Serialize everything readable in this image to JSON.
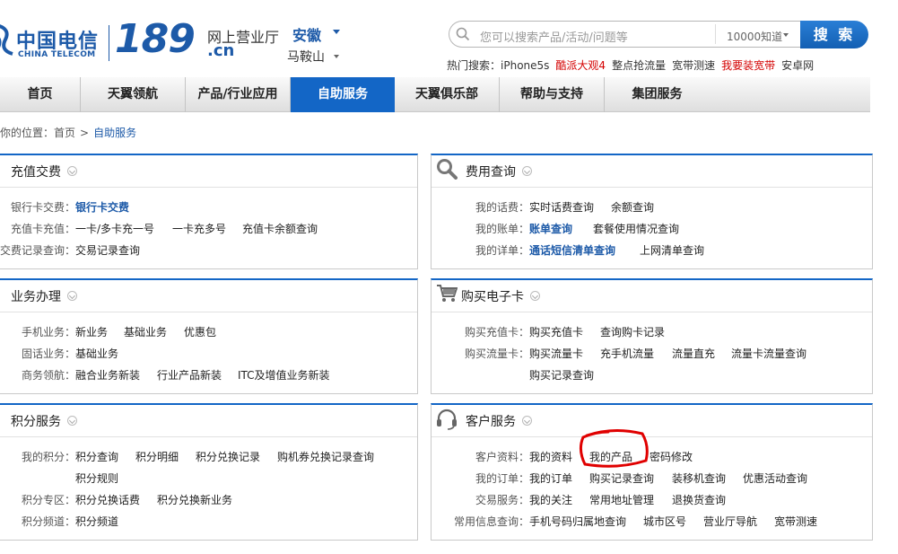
{
  "header": {
    "logo_cn": "中国电信",
    "logo_en": "CHINA TELECOM",
    "logo_num": "189",
    "logo_domain": ".cn",
    "hall": "网上营业厅",
    "province": "安徽",
    "city": "马鞍山",
    "search_placeholder": "您可以搜索产品/活动/问题等",
    "search_scope": "10000知道",
    "search_button": "搜 索",
    "hot_label": "热门搜索：",
    "hot_items": [
      "iPhone5s",
      "酷派大观4",
      "整点抢流量",
      "宽带测速",
      "我要装宽带",
      "安卓网"
    ],
    "accent": "#1366c6",
    "hot_red": "#d40000"
  },
  "nav": [
    "首页",
    "天翼领航",
    "产品/行业应用",
    "自助服务",
    "天翼俱乐部",
    "帮助与支持",
    "集团服务"
  ],
  "breadcrumb": {
    "prefix": "你的位置：",
    "home": "首页",
    "sep": ">",
    "current": "自助服务"
  },
  "panels": {
    "recharge": {
      "title": "充值交费",
      "rows": [
        {
          "label": "银行卡交费：",
          "links": [
            "银行卡交费"
          ]
        },
        {
          "label": "充值卡充值：",
          "links": [
            "一卡/多卡充一号",
            "一卡充多号",
            "充值卡余额查询"
          ]
        },
        {
          "label": "交费记录查询：",
          "links": [
            "交易记录查询"
          ]
        }
      ]
    },
    "fee": {
      "title": "费用查询",
      "icon": "search-icon",
      "rows": [
        {
          "label": "我的话费：",
          "links": [
            "实时话费查询",
            "余额查询"
          ]
        },
        {
          "label": "我的账单：",
          "links": [
            "账单查询",
            "套餐使用情况查询"
          ]
        },
        {
          "label": "我的详单：",
          "links": [
            "通话短信清单查询",
            "上网清单查询"
          ]
        }
      ]
    },
    "business": {
      "title": "业务办理",
      "rows": [
        {
          "label": "手机业务：",
          "links": [
            "新业务",
            "基础业务",
            "优惠包"
          ]
        },
        {
          "label": "固话业务：",
          "links": [
            "基础业务"
          ]
        },
        {
          "label": "商务领航：",
          "links": [
            "融合业务新装",
            "行业产品新装",
            "ITC及增值业务新装"
          ]
        }
      ]
    },
    "ecard": {
      "title": "购买电子卡",
      "icon": "cart-icon",
      "rows": [
        {
          "label": "购买充值卡：",
          "links": [
            "购买充值卡",
            "查询购卡记录"
          ]
        },
        {
          "label": "购买流量卡：",
          "links": [
            "购买流量卡",
            "充手机流量",
            "流量直充",
            "流量卡流量查询"
          ]
        },
        {
          "label": "",
          "links": [
            "购买记录查询"
          ]
        }
      ]
    },
    "points": {
      "title": "积分服务",
      "rows": [
        {
          "label": "我的积分：",
          "links": [
            "积分查询",
            "积分明细",
            "积分兑换记录",
            "购机券兑换记录查询"
          ]
        },
        {
          "label": "",
          "links": [
            "积分规则"
          ]
        },
        {
          "label": "积分专区：",
          "links": [
            "积分兑换话费",
            "积分兑换新业务"
          ]
        },
        {
          "label": "积分频道：",
          "links": [
            "积分频道"
          ]
        }
      ]
    },
    "customer": {
      "title": "客户服务",
      "icon": "headset-icon",
      "rows": [
        {
          "label": "客户资料：",
          "links": [
            "我的资料",
            "我的产品",
            "密码修改"
          ]
        },
        {
          "label": "我的订单：",
          "links": [
            "我的订单",
            "购买记录查询",
            "装移机查询",
            "优惠活动查询"
          ]
        },
        {
          "label": "交易服务：",
          "links": [
            "我的关注",
            "常用地址管理",
            "退换货查询"
          ]
        },
        {
          "label": "常用信息查询：",
          "links": [
            "手机号码归属地查询",
            "城市区号",
            "营业厅导航",
            "宽带测速"
          ]
        }
      ]
    }
  },
  "annotation": {
    "color": "#e00000"
  }
}
